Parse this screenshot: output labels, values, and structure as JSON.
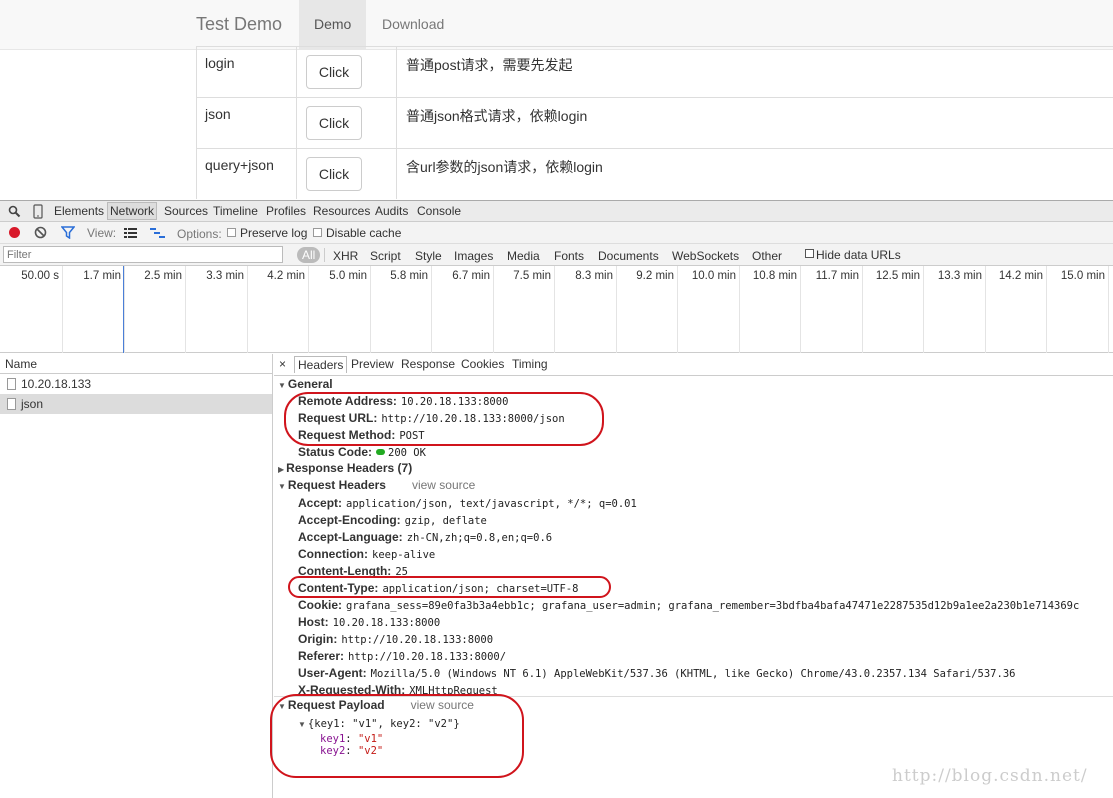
{
  "page": {
    "brand": "Test Demo",
    "nav": [
      "Demo",
      "Download"
    ],
    "rows": [
      {
        "name": "login",
        "button": "Click",
        "desc": "普通post请求，需要先发起"
      },
      {
        "name": "json",
        "button": "Click",
        "desc": "普通json格式请求，依赖login"
      },
      {
        "name": "query+json",
        "button": "Click",
        "desc": "含url参数的json请求，依赖login"
      }
    ]
  },
  "devtools": {
    "panels": [
      "Elements",
      "Network",
      "Sources",
      "Timeline",
      "Profiles",
      "Resources",
      "Audits",
      "Console"
    ],
    "toolbar": {
      "view_label": "View:",
      "options_label": "Options:",
      "preserve_log": "Preserve log",
      "disable_cache": "Disable cache"
    },
    "filter": {
      "placeholder": "Filter",
      "types": [
        "All",
        "XHR",
        "Script",
        "Style",
        "Images",
        "Media",
        "Fonts",
        "Documents",
        "WebSockets",
        "Other"
      ],
      "hide_data_urls": "Hide data URLs"
    },
    "timeline_ticks": [
      "50.00 s",
      "1.7 min",
      "2.5 min",
      "3.3 min",
      "4.2 min",
      "5.0 min",
      "5.8 min",
      "6.7 min",
      "7.5 min",
      "8.3 min",
      "9.2 min",
      "10.0 min",
      "10.8 min",
      "11.7 min",
      "12.5 min",
      "13.3 min",
      "14.2 min",
      "15.0 min"
    ],
    "name_header": "Name",
    "requests": [
      "10.20.18.133",
      "json"
    ],
    "detail_tabs": [
      "×",
      "Headers",
      "Preview",
      "Response",
      "Cookies",
      "Timing"
    ],
    "general": {
      "title": "General",
      "remote_address_k": "Remote Address:",
      "remote_address_v": "10.20.18.133:8000",
      "request_url_k": "Request URL:",
      "request_url_v": "http://10.20.18.133:8000/json",
      "request_method_k": "Request Method:",
      "request_method_v": "POST",
      "status_code_k": "Status Code:",
      "status_code_v": "200 OK"
    },
    "response_headers": "Response Headers (7)",
    "request_headers": {
      "title": "Request Headers",
      "view_source": "view source",
      "items": [
        {
          "k": "Accept:",
          "v": "application/json, text/javascript, */*; q=0.01"
        },
        {
          "k": "Accept-Encoding:",
          "v": "gzip, deflate"
        },
        {
          "k": "Accept-Language:",
          "v": "zh-CN,zh;q=0.8,en;q=0.6"
        },
        {
          "k": "Connection:",
          "v": "keep-alive"
        },
        {
          "k": "Content-Length:",
          "v": "25"
        },
        {
          "k": "Content-Type:",
          "v": "application/json; charset=UTF-8"
        },
        {
          "k": "Cookie:",
          "v": "grafana_sess=89e0fa3b3a4ebb1c; grafana_user=admin; grafana_remember=3bdfba4bafa47471e2287535d12b9a1ee2a230b1e714369c"
        },
        {
          "k": "Host:",
          "v": "10.20.18.133:8000"
        },
        {
          "k": "Origin:",
          "v": "http://10.20.18.133:8000"
        },
        {
          "k": "Referer:",
          "v": "http://10.20.18.133:8000/"
        },
        {
          "k": "User-Agent:",
          "v": "Mozilla/5.0 (Windows NT 6.1) AppleWebKit/537.36 (KHTML, like Gecko) Chrome/43.0.2357.134 Safari/537.36"
        },
        {
          "k": "X-Requested-With:",
          "v": "XMLHttpRequest"
        }
      ]
    },
    "payload": {
      "title": "Request Payload",
      "view_source": "view source",
      "summary": "{key1: \"v1\", key2: \"v2\"}",
      "key1": "key1",
      "val1": "\"v1\"",
      "key2": "key2",
      "val2": "\"v2\""
    }
  },
  "watermark": "http://blog.csdn.net/"
}
